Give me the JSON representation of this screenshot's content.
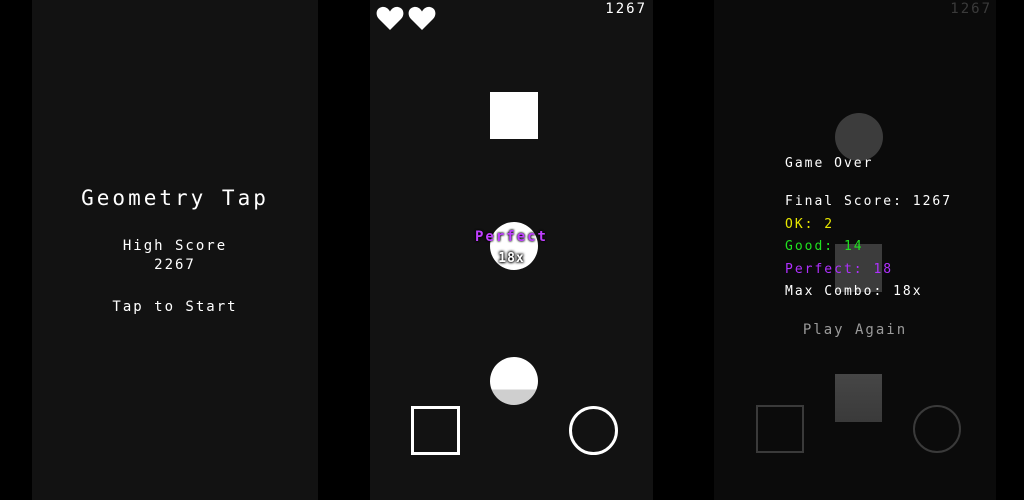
{
  "start_screen": {
    "title": "Geometry Tap",
    "high_score_label": "High Score",
    "high_score_value": "2267",
    "tap_to_start": "Tap to Start"
  },
  "gameplay": {
    "lives": 2,
    "score": "1267",
    "feedback_label": "Perfect",
    "combo_label": "18x",
    "colors": {
      "perfect": "#c040ff"
    }
  },
  "game_over": {
    "score": "1267",
    "title": "Game Over",
    "final_score": "Final Score: 1267",
    "ok": "OK: 2",
    "good": "Good: 14",
    "perfect": "Perfect: 18",
    "max_combo": "Max Combo: 18x",
    "play_again": "Play Again",
    "colors": {
      "ok": "#e8e800",
      "good": "#20e020",
      "perfect": "#b030ff"
    }
  }
}
